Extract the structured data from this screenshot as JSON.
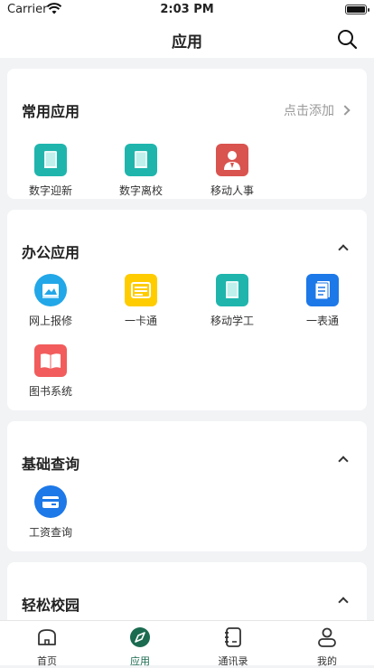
{
  "status_bar": {
    "carrier": "Carrier",
    "time": "2:03 PM"
  },
  "nav": {
    "title": "应用"
  },
  "common": {
    "title": "常用应用",
    "action": "点击添加",
    "apps": [
      {
        "label": "数字迎新",
        "icon": "book-icon"
      },
      {
        "label": "数字离校",
        "icon": "book-icon"
      },
      {
        "label": "移动人事",
        "icon": "person-icon"
      }
    ]
  },
  "office": {
    "title": "办公应用",
    "apps": [
      {
        "label": "网上报修",
        "icon": "image-icon"
      },
      {
        "label": "一卡通",
        "icon": "card-icon"
      },
      {
        "label": "移动学工",
        "icon": "book-icon"
      },
      {
        "label": "一表通",
        "icon": "document-icon"
      },
      {
        "label": "图书系统",
        "icon": "open-book-icon"
      }
    ]
  },
  "query": {
    "title": "基础查询",
    "apps": [
      {
        "label": "工资查询",
        "icon": "wallet-icon"
      }
    ]
  },
  "campus": {
    "title": "轻松校园"
  },
  "tabs": [
    {
      "label": "首页",
      "icon": "home-icon"
    },
    {
      "label": "应用",
      "icon": "compass-icon"
    },
    {
      "label": "通讯录",
      "icon": "contacts-icon"
    },
    {
      "label": "我的",
      "icon": "user-icon"
    }
  ],
  "colors": {
    "accent": "#1a6b4f",
    "teal": "#1fb5ad",
    "red": "#d9534f",
    "yellow": "#ffcc00",
    "blue": "#1d78e8",
    "salmon": "#f25c5c"
  }
}
